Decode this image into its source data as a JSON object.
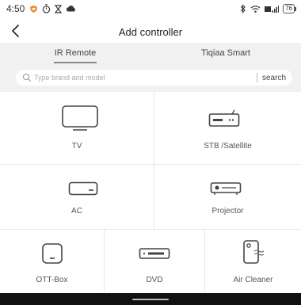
{
  "status_bar": {
    "time": "4:50",
    "battery": "76",
    "icons_left": [
      "shield-heart-icon",
      "timer-icon",
      "hourglass-icon",
      "cloud-icon"
    ],
    "icons_right": [
      "bluetooth-icon",
      "wifi-icon",
      "signal-icon",
      "battery-icon"
    ]
  },
  "header": {
    "title": "Add controller",
    "back_icon": "chevron-left-icon"
  },
  "tabs": [
    {
      "label": "IR Remote",
      "active": true
    },
    {
      "label": "Tiqiaa Smart",
      "active": false
    }
  ],
  "search": {
    "placeholder": "Type brand and model",
    "button_label": "search"
  },
  "devices": [
    {
      "label": "TV",
      "icon": "tv-icon"
    },
    {
      "label": "STB /Satellite",
      "icon": "set-top-box-icon"
    },
    {
      "label": "AC",
      "icon": "air-conditioner-icon"
    },
    {
      "label": "Projector",
      "icon": "projector-icon"
    },
    {
      "label": "OTT-Box",
      "icon": "ott-box-icon"
    },
    {
      "label": "DVD",
      "icon": "dvd-player-icon"
    },
    {
      "label": "Air Cleaner",
      "icon": "air-purifier-icon"
    }
  ],
  "colors": {
    "tabs_background": "#f1f1f1",
    "icon_stroke": "#444444",
    "nav_bar": "#111111"
  }
}
